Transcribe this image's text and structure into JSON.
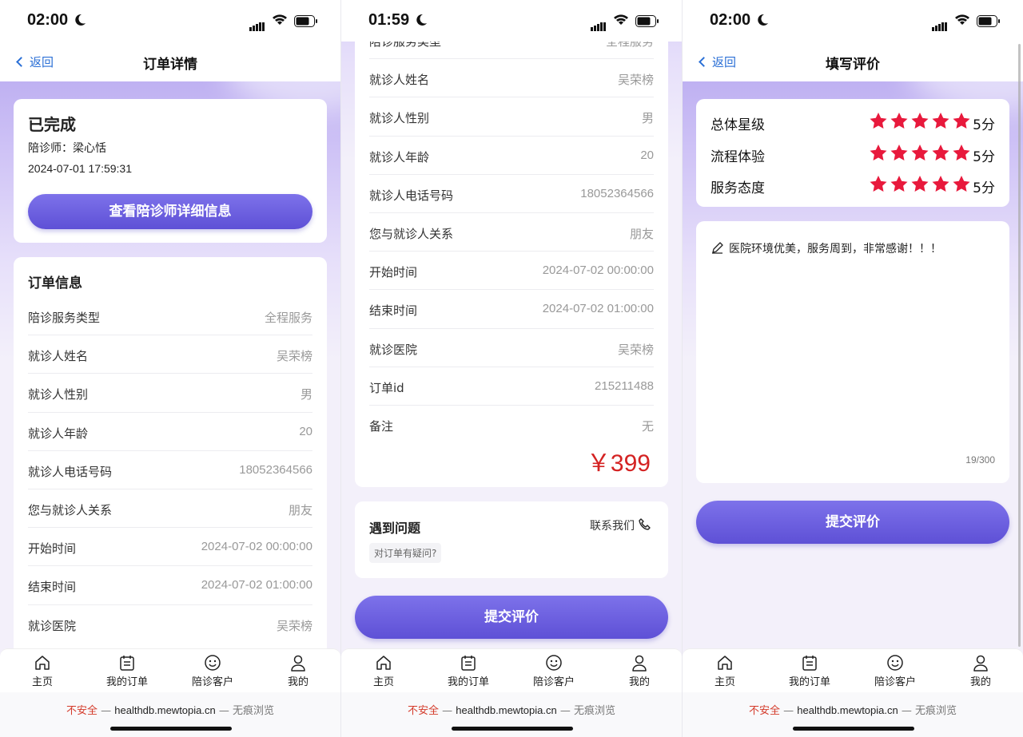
{
  "url_bar": {
    "warning": "不安全",
    "separator": " — ",
    "host": "healthdb.mewtopia.cn",
    "separator2": " — ",
    "mode": "无痕浏览"
  },
  "tabbar": {
    "items": [
      {
        "label": "主页",
        "icon": "home-icon"
      },
      {
        "label": "我的订单",
        "icon": "orders-icon"
      },
      {
        "label": "陪诊客户",
        "icon": "smiley-icon"
      },
      {
        "label": "我的",
        "icon": "user-icon"
      }
    ]
  },
  "screen1": {
    "time": "02:00",
    "nav": {
      "back": "返回",
      "title": "订单详情"
    },
    "status_card": {
      "status": "已完成",
      "escort": "陪诊师：梁心恬",
      "datetime": "2024-07-01 17:59:31",
      "button": "查看陪诊师详细信息"
    },
    "order_info": {
      "title": "订单信息",
      "rows": [
        {
          "k": "陪诊服务类型",
          "v": "全程服务"
        },
        {
          "k": "就诊人姓名",
          "v": "吴荣榜"
        },
        {
          "k": "就诊人性别",
          "v": "男"
        },
        {
          "k": "就诊人年龄",
          "v": "20"
        },
        {
          "k": "就诊人电话号码",
          "v": "18052364566"
        },
        {
          "k": "您与就诊人关系",
          "v": "朋友"
        },
        {
          "k": "开始时间",
          "v": "2024-07-02 00:00:00"
        },
        {
          "k": "结束时间",
          "v": "2024-07-02 01:00:00"
        },
        {
          "k": "就诊医院",
          "v": "吴荣榜"
        }
      ]
    }
  },
  "screen2": {
    "time": "01:59",
    "rows": [
      {
        "k": "陪诊服务类型",
        "v": "全程服务"
      },
      {
        "k": "就诊人姓名",
        "v": "吴荣榜"
      },
      {
        "k": "就诊人性别",
        "v": "男"
      },
      {
        "k": "就诊人年龄",
        "v": "20"
      },
      {
        "k": "就诊人电话号码",
        "v": "18052364566"
      },
      {
        "k": "您与就诊人关系",
        "v": "朋友"
      },
      {
        "k": "开始时间",
        "v": "2024-07-02 00:00:00"
      },
      {
        "k": "结束时间",
        "v": "2024-07-02 01:00:00"
      },
      {
        "k": "就诊医院",
        "v": "吴荣榜"
      },
      {
        "k": "订单id",
        "v": "215211488"
      },
      {
        "k": "备注",
        "v": "无"
      }
    ],
    "price": "￥399",
    "problem": {
      "title": "遇到问题",
      "contact": "联系我们",
      "chip": "对订单有疑问?"
    },
    "submit": "提交评价"
  },
  "screen3": {
    "time": "02:00",
    "nav": {
      "back": "返回",
      "title": "填写评价"
    },
    "ratings": [
      {
        "label": "总体星级",
        "stars": 5,
        "score": "5分"
      },
      {
        "label": "流程体验",
        "stars": 5,
        "score": "5分"
      },
      {
        "label": "服务态度",
        "stars": 5,
        "score": "5分"
      }
    ],
    "review": {
      "text": "医院环境优美，服务周到，非常感谢！！！",
      "counter": "19/300"
    },
    "submit": "提交评价"
  },
  "colors": {
    "accent": "#6a5ee0",
    "link": "#2a6fd6",
    "price": "#d42222",
    "star": "#e8193c"
  }
}
